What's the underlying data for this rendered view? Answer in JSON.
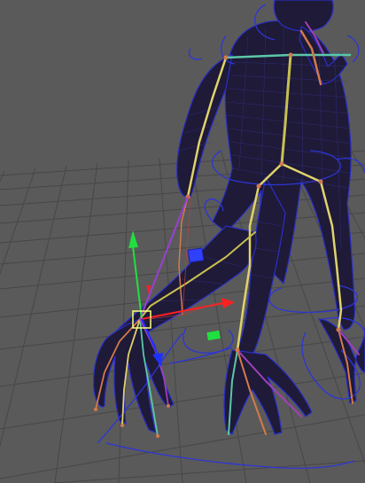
{
  "viewport": {
    "background_color": "#5a5a5a",
    "grid_color": "#474747",
    "mesh_color": "#1e1a38",
    "wire_color": "#2a2fc8",
    "curve_color": "#2d35d6",
    "bone_colors": [
      "#e0d36a",
      "#c8c050",
      "#d47a4a",
      "#5ac8a8",
      "#a040b8",
      "#8fd0ff"
    ],
    "manipulator": {
      "x_axis_color": "#ff2020",
      "y_axis_color": "#20e040",
      "z_axis_color": "#2030ff",
      "scale_box_color": "#3040ff",
      "selection_box_color": "#ffff80",
      "ik_handle_color": "#9a40d0"
    }
  }
}
